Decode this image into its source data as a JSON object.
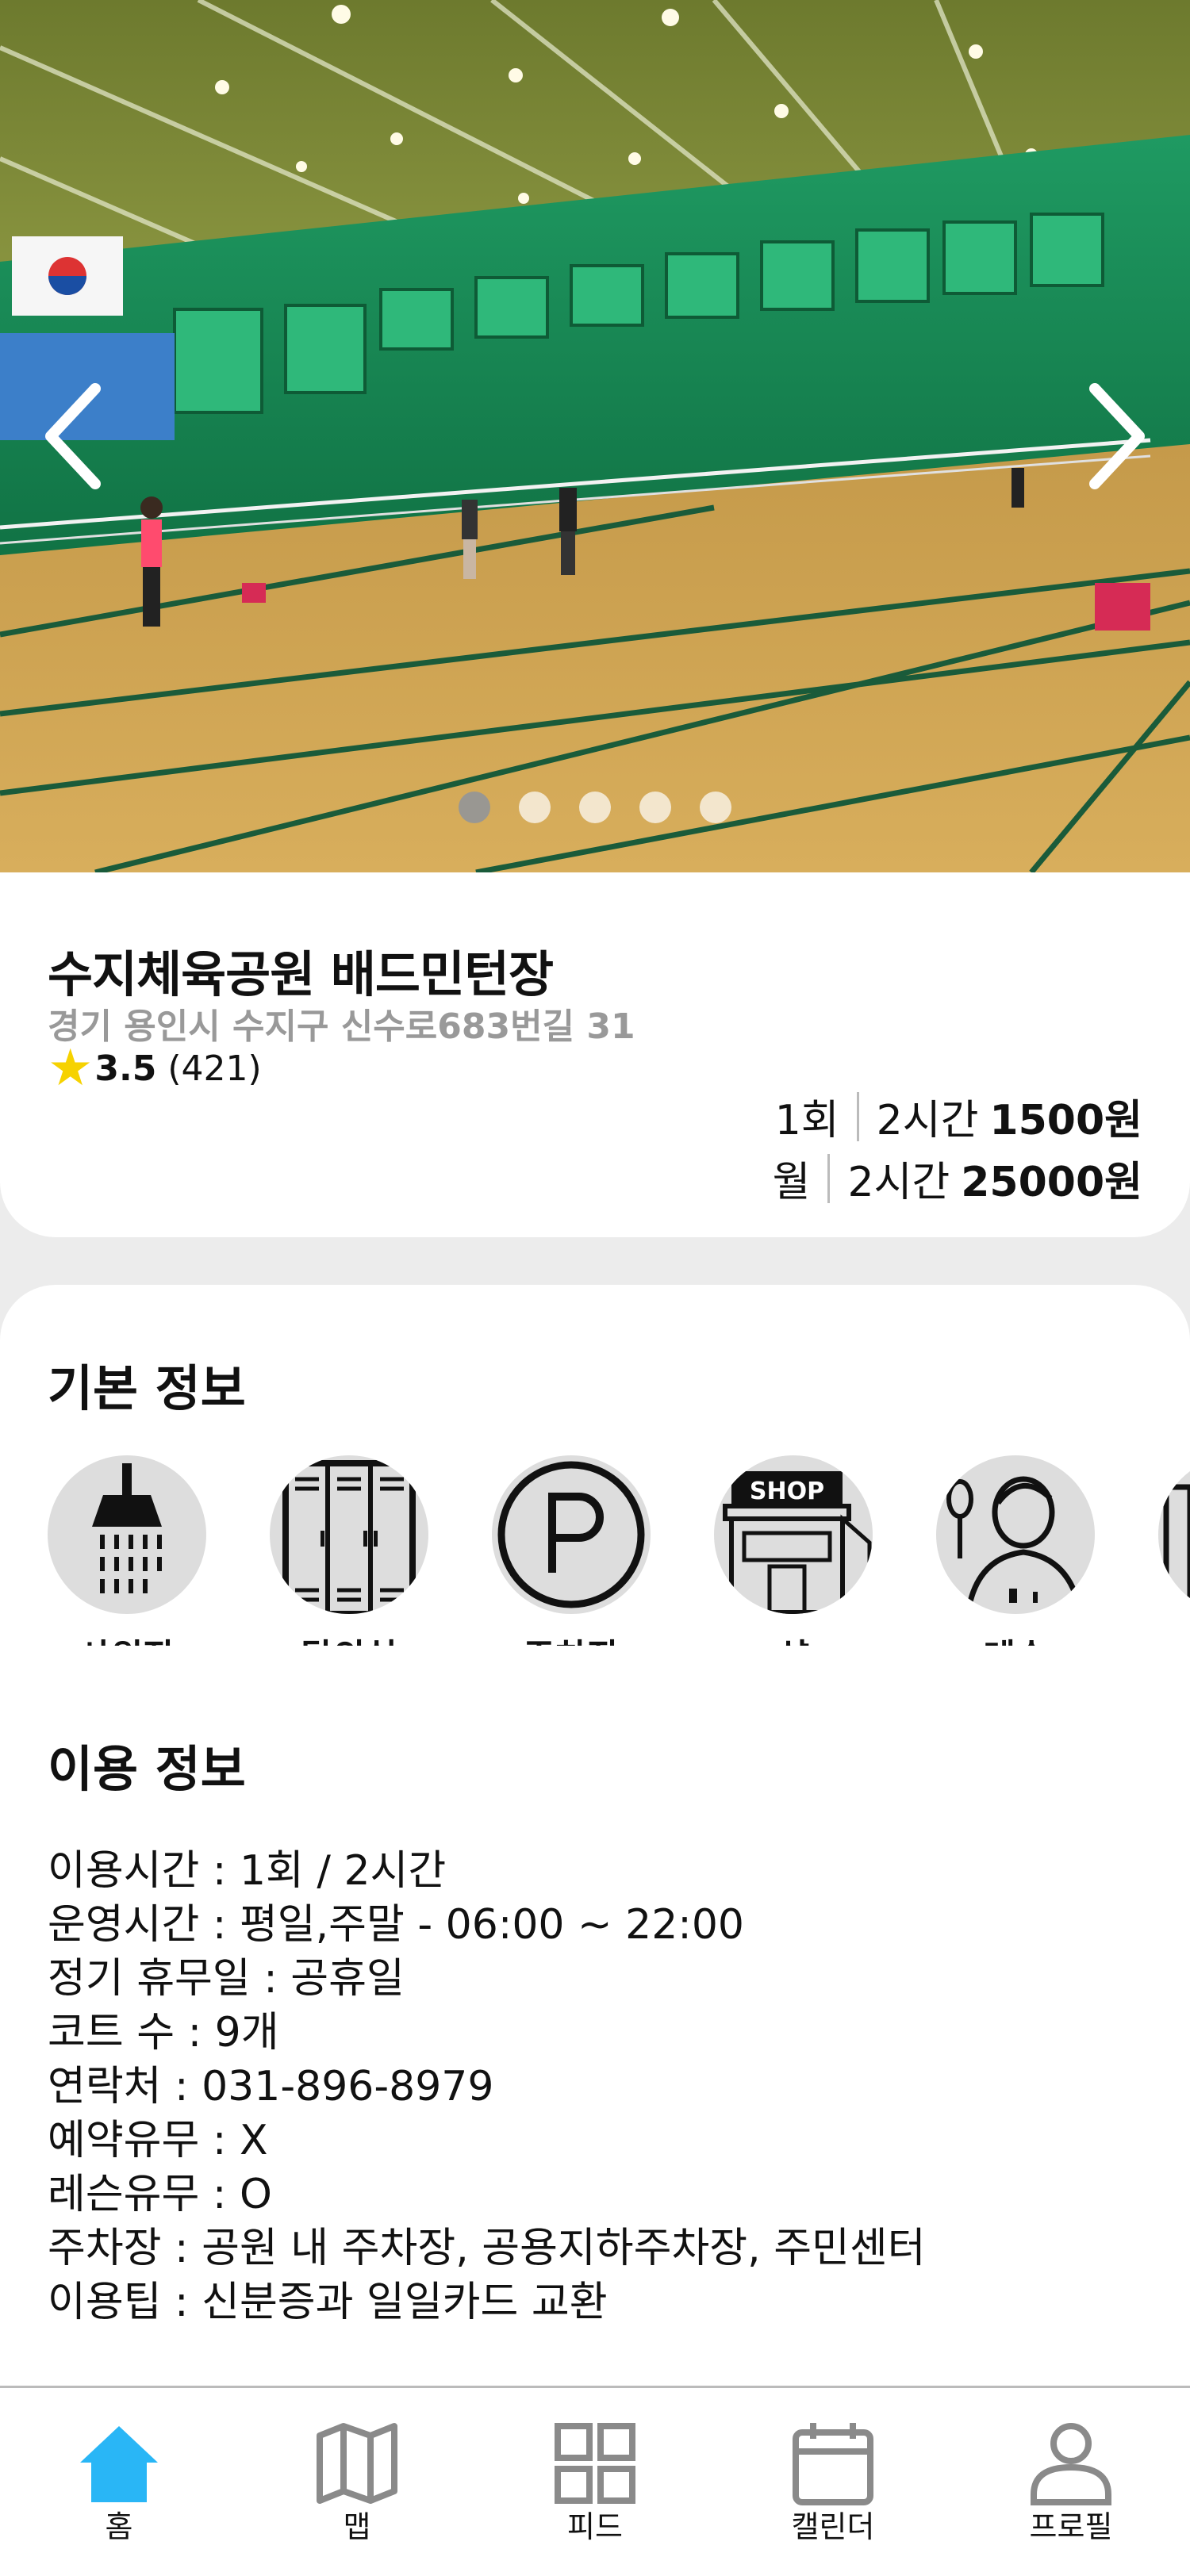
{
  "hero": {
    "slides_total": 5,
    "active_slide": 1
  },
  "place": {
    "name": "수지체육공원 배드민턴장",
    "address": "경기 용인시 수지구 신수로683번길 31",
    "rating": "3.5",
    "review_count": "(421)"
  },
  "prices": [
    {
      "unit": "1회",
      "duration": "2시간",
      "amount": "1500원"
    },
    {
      "unit": "월",
      "duration": "2시간",
      "amount": "25000원"
    }
  ],
  "basic_info": {
    "title": "기본 정보",
    "amenities": [
      {
        "label": "샤워장",
        "icon": "shower-icon"
      },
      {
        "label": "탈의실",
        "icon": "locker-icon"
      },
      {
        "label": "주차장",
        "icon": "parking-icon"
      },
      {
        "label": "샵",
        "icon": "shop-icon"
      },
      {
        "label": "레슨",
        "icon": "coach-icon"
      }
    ]
  },
  "usage_info": {
    "title": "이용 정보",
    "lines": [
      "이용시간 : 1회 / 2시간",
      "운영시간 : 평일,주말 - 06:00 ~ 22:00",
      "정기 휴무일 : 공휴일",
      "코트 수 : 9개",
      "연락처 : 031-896-8979",
      "예약유무 : X",
      "레슨유무 : O",
      "주차장 : 공원 내 주차장, 공용지하주차장, 주민센터",
      "이용팁 : 신분증과 일일카드 교환"
    ]
  },
  "tabbar": {
    "active_color": "#29b6f6",
    "inactive_color": "#8a8a8a",
    "items": [
      {
        "label": "홈",
        "icon": "home-icon",
        "active": true
      },
      {
        "label": "맵",
        "icon": "map-icon",
        "active": false
      },
      {
        "label": "피드",
        "icon": "grid-icon",
        "active": false
      },
      {
        "label": "캘린더",
        "icon": "calendar-icon",
        "active": false
      },
      {
        "label": "프로필",
        "icon": "profile-icon",
        "active": false
      }
    ]
  }
}
